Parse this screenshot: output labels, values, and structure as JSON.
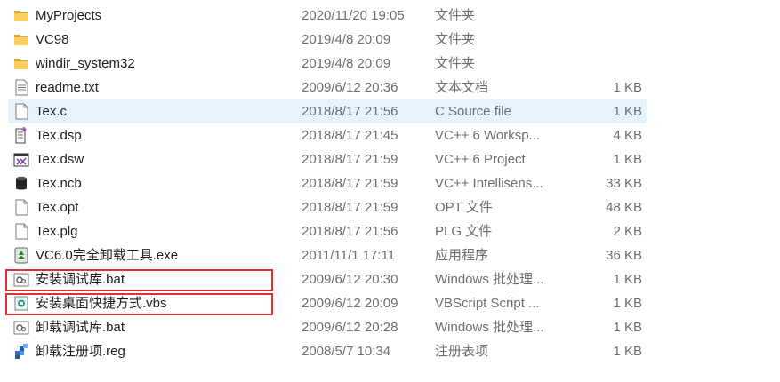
{
  "files": [
    {
      "name": "MyProjects",
      "date": "2020/11/20 19:05",
      "type": "文件夹",
      "size": "",
      "icon": "folder-icon"
    },
    {
      "name": "VC98",
      "date": "2019/4/8 20:09",
      "type": "文件夹",
      "size": "",
      "icon": "folder-icon"
    },
    {
      "name": "windir_system32",
      "date": "2019/4/8 20:09",
      "type": "文件夹",
      "size": "",
      "icon": "folder-icon"
    },
    {
      "name": "readme.txt",
      "date": "2009/6/12 20:36",
      "type": "文本文档",
      "size": "1 KB",
      "icon": "text-file-icon"
    },
    {
      "name": "Tex.c",
      "date": "2018/8/17 21:56",
      "type": "C Source file",
      "size": "1 KB",
      "icon": "blank-file-icon",
      "selected": true
    },
    {
      "name": "Tex.dsp",
      "date": "2018/8/17 21:45",
      "type": "VC++ 6 Worksp...",
      "size": "4 KB",
      "icon": "vc-workspace-icon"
    },
    {
      "name": "Tex.dsw",
      "date": "2018/8/17 21:59",
      "type": "VC++ 6 Project",
      "size": "1 KB",
      "icon": "visual-studio-icon"
    },
    {
      "name": "Tex.ncb",
      "date": "2018/8/17 21:59",
      "type": "VC++ Intellisens...",
      "size": "33 KB",
      "icon": "database-icon"
    },
    {
      "name": "Tex.opt",
      "date": "2018/8/17 21:59",
      "type": "OPT 文件",
      "size": "48 KB",
      "icon": "blank-file-icon"
    },
    {
      "name": "Tex.plg",
      "date": "2018/8/17 21:56",
      "type": "PLG 文件",
      "size": "2 KB",
      "icon": "blank-file-icon"
    },
    {
      "name": "VC6.0完全卸载工具.exe",
      "date": "2011/11/1 17:11",
      "type": "应用程序",
      "size": "36 KB",
      "icon": "recycle-app-icon"
    },
    {
      "name": "安装调试库.bat",
      "date": "2009/6/12 20:30",
      "type": "Windows 批处理...",
      "size": "1 KB",
      "icon": "batch-file-icon",
      "boxed": true
    },
    {
      "name": "安装桌面快捷方式.vbs",
      "date": "2009/6/12 20:09",
      "type": "VBScript Script ...",
      "size": "1 KB",
      "icon": "vbscript-file-icon",
      "boxed": true
    },
    {
      "name": "卸载调试库.bat",
      "date": "2009/6/12 20:28",
      "type": "Windows 批处理...",
      "size": "1 KB",
      "icon": "batch-file-icon"
    },
    {
      "name": "卸载注册项.reg",
      "date": "2008/5/7 10:34",
      "type": "注册表项",
      "size": "1 KB",
      "icon": "registry-file-icon"
    }
  ],
  "colors": {
    "selection": "#e5f3ff",
    "highlight_box": "#e03030",
    "folder": "#f4c44e"
  }
}
